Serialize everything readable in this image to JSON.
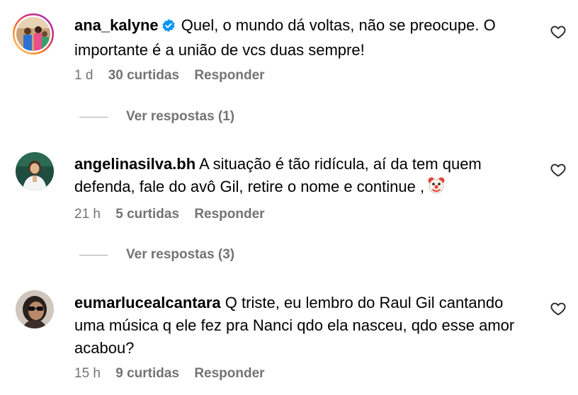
{
  "comments": [
    {
      "username": "ana_kalyne",
      "verified": true,
      "text": "Quel, o mundo dá voltas, não se preocupe. O importante é a união de vcs duas sempre!",
      "time": "1 d",
      "likes": "30 curtidas",
      "reply_label": "Responder",
      "view_replies": "Ver respostas (1)"
    },
    {
      "username": "angelinasilva.bh",
      "verified": false,
      "text": "A situação é tão ridícula, aí da tem quem defenda, fale do avô Gil, retire o nome e continue ,",
      "emoji": "clown-face",
      "time": "21 h",
      "likes": "5 curtidas",
      "reply_label": "Responder",
      "view_replies": "Ver respostas (3)"
    },
    {
      "username": "eumarlucealcantara",
      "verified": false,
      "text": "Q triste, eu lembro do Raul Gil cantando uma música q ele fez pra Nanci qdo ela nasceu, qdo esse amor acabou?",
      "time": "15 h",
      "likes": "9 curtidas",
      "reply_label": "Responder"
    }
  ],
  "colors": {
    "text": "#000000",
    "meta": "#737373",
    "verified": "#0095f6",
    "divider": "#a8a8a8"
  }
}
